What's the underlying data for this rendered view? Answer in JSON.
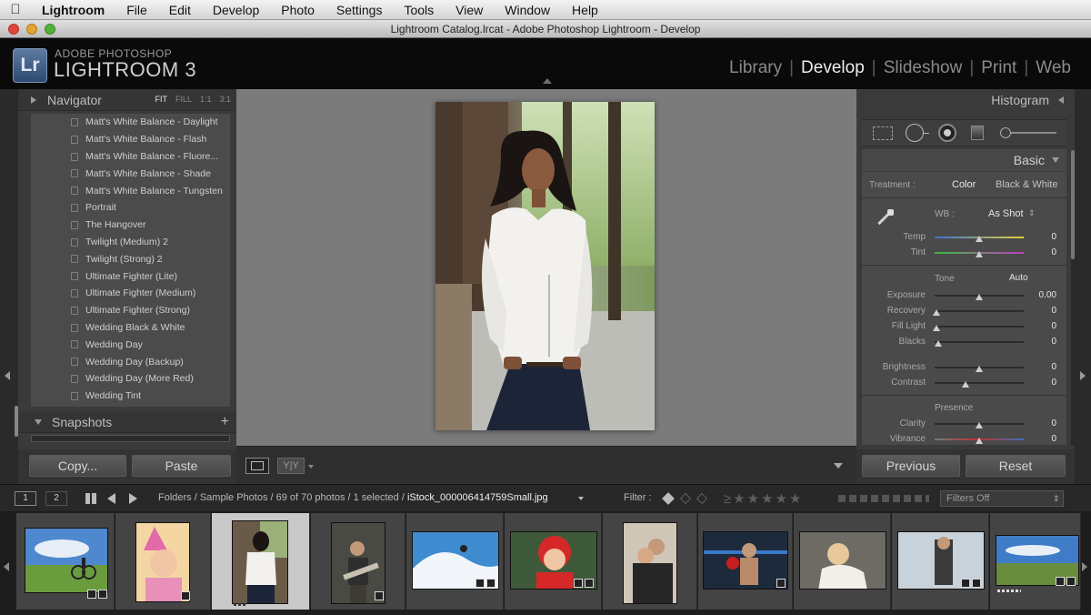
{
  "menubar": {
    "app": "Lightroom",
    "items": [
      "File",
      "Edit",
      "Develop",
      "Photo",
      "Settings",
      "Tools",
      "View",
      "Window",
      "Help"
    ]
  },
  "window": {
    "title": "Lightroom Catalog.lrcat - Adobe Photoshop Lightroom - Develop"
  },
  "identity": {
    "logo": "Lr",
    "brand_sub": "ADOBE PHOTOSHOP",
    "brand_main": "LIGHTROOM 3"
  },
  "modules": [
    {
      "label": "Library",
      "active": false
    },
    {
      "label": "Develop",
      "active": true
    },
    {
      "label": "Slideshow",
      "active": false
    },
    {
      "label": "Print",
      "active": false
    },
    {
      "label": "Web",
      "active": false
    }
  ],
  "navigator": {
    "title": "Navigator",
    "zoom_options": [
      "FIT",
      "FILL",
      "1:1",
      "3:1"
    ],
    "zoom_selected": "FIT"
  },
  "presets": [
    "Matt's White Balance - Daylight",
    "Matt's White Balance - Flash",
    "Matt's White Balance - Fluore...",
    "Matt's White Balance - Shade",
    "Matt's White Balance - Tungsten",
    "Portrait",
    "The Hangover",
    "Twilight (Medium) 2",
    "Twilight (Strong) 2",
    "Ultimate Fighter (Lite)",
    "Ultimate Fighter (Medium)",
    "Ultimate Fighter (Strong)",
    "Wedding Black & White",
    "Wedding Day",
    "Wedding Day (Backup)",
    "Wedding Day (More Red)",
    "Wedding Tint"
  ],
  "snapshots": {
    "title": "Snapshots",
    "add": "+"
  },
  "left_buttons": {
    "copy": "Copy...",
    "paste": "Paste"
  },
  "right_panel": {
    "histogram_title": "Histogram",
    "basic_title": "Basic",
    "treatment_label": "Treatment :",
    "treatment_color": "Color",
    "treatment_bw": "Black & White",
    "wb_label": "WB :",
    "wb_value": "As Shot",
    "temp": {
      "label": "Temp",
      "value": "0"
    },
    "tint": {
      "label": "Tint",
      "value": "0"
    },
    "tone_label": "Tone",
    "auto_label": "Auto",
    "tone_sliders": [
      {
        "label": "Exposure",
        "value": "0.00"
      },
      {
        "label": "Recovery",
        "value": "0"
      },
      {
        "label": "Fill Light",
        "value": "0"
      },
      {
        "label": "Blacks",
        "value": "0"
      }
    ],
    "tone_sliders2": [
      {
        "label": "Brightness",
        "value": "0"
      },
      {
        "label": "Contrast",
        "value": "0"
      }
    ],
    "presence_label": "Presence",
    "presence_sliders": [
      {
        "label": "Clarity",
        "value": "0"
      },
      {
        "label": "Vibrance",
        "value": "0"
      }
    ]
  },
  "right_buttons": {
    "previous": "Previous",
    "reset": "Reset"
  },
  "filmbar": {
    "view1": "1",
    "view2": "2",
    "path_prefix": "Folders / Sample Photos / 69 of 70 photos / 1 selected / ",
    "filename": "iStock_000006414759Small.jpg",
    "filter_label": "Filter :",
    "filters_off": "Filters Off"
  },
  "colors": {
    "accent": "#ececec",
    "panel": "#3a3a3a",
    "canvas": "#7b7b7b",
    "temp_gradient": [
      "#3b6fd1",
      "#e0d23a"
    ],
    "tint_gradient": [
      "#3dbb3d",
      "#c23dc2"
    ]
  },
  "icons": [
    "apple-icon",
    "grid-view-icon",
    "back-arrow-icon",
    "forward-arrow-icon",
    "eyedropper-icon",
    "crop-icon",
    "spot-removal-icon",
    "red-eye-icon",
    "graduated-filter-icon",
    "adjustment-brush-icon",
    "loupe-view-icon",
    "flag-icon",
    "star-icon"
  ]
}
